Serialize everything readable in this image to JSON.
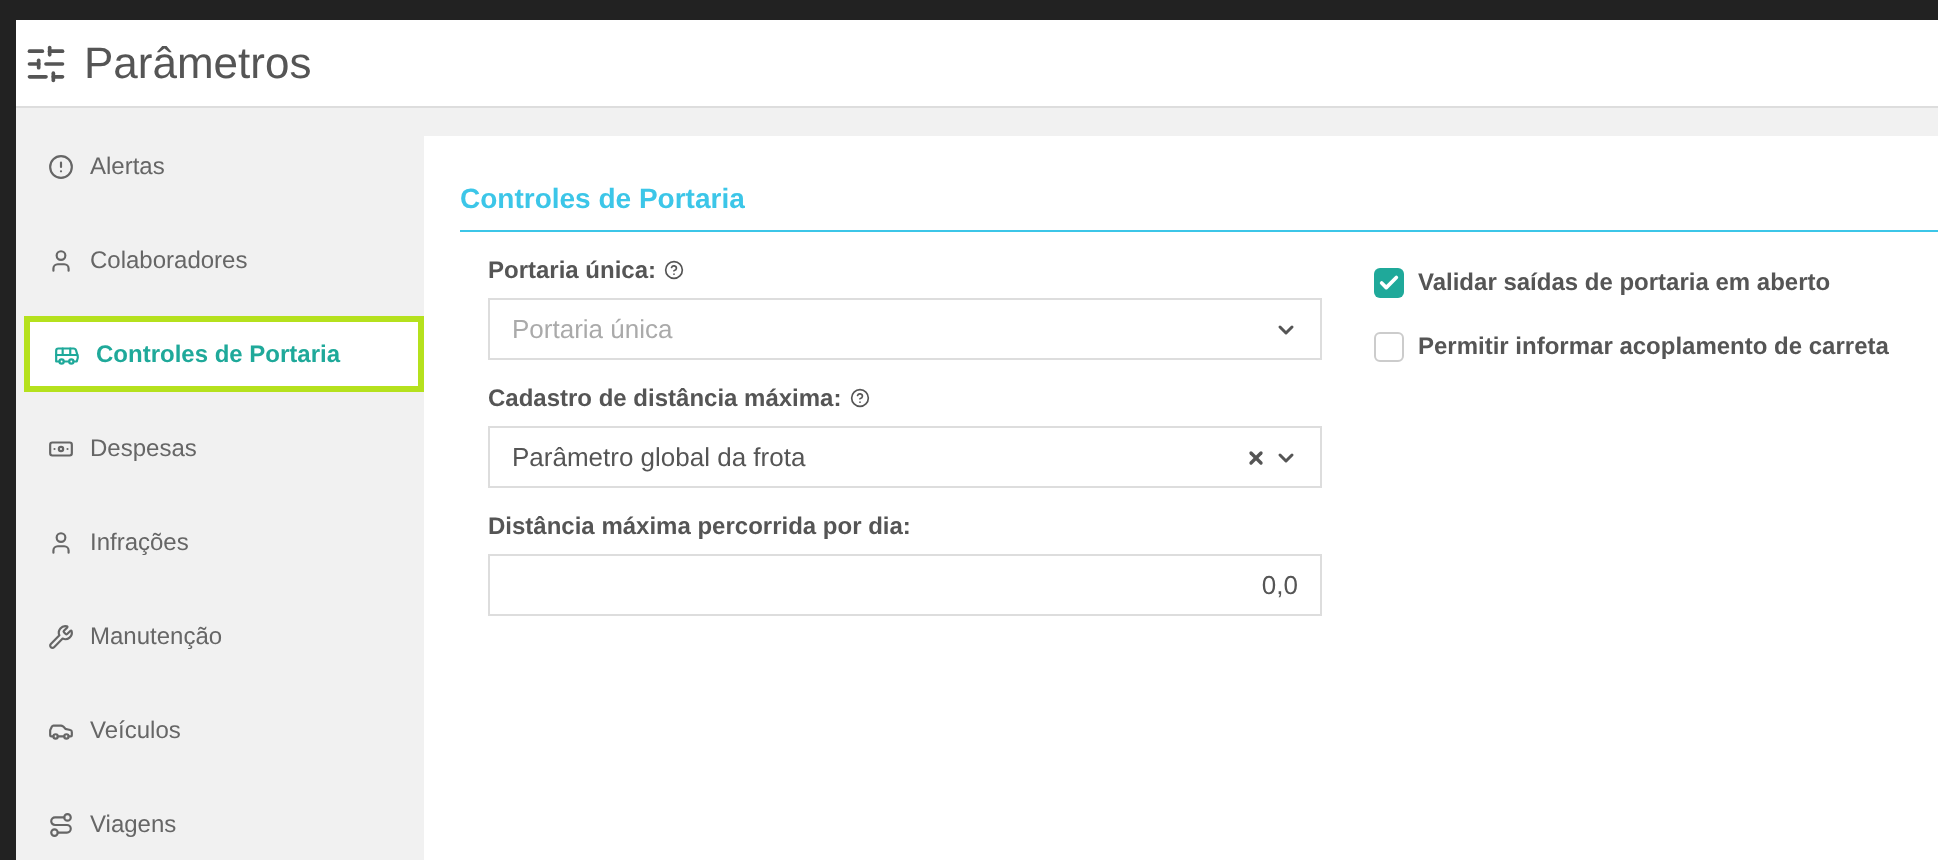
{
  "header": {
    "title": "Parâmetros"
  },
  "sidebar": {
    "items": [
      {
        "label": "Alertas",
        "selected": false
      },
      {
        "label": "Colaboradores",
        "selected": false
      },
      {
        "label": "Controles de Portaria",
        "selected": true
      },
      {
        "label": "Despesas",
        "selected": false
      },
      {
        "label": "Infrações",
        "selected": false
      },
      {
        "label": "Manutenção",
        "selected": false
      },
      {
        "label": "Veículos",
        "selected": false
      },
      {
        "label": "Viagens",
        "selected": false
      }
    ]
  },
  "section": {
    "title": "Controles de Portaria",
    "fields": [
      {
        "kind": "select",
        "label": "Portaria única:",
        "help": true,
        "placeholder": "Portaria única",
        "clearable": false
      },
      {
        "kind": "select",
        "label": "Cadastro de distância máxima:",
        "help": true,
        "value": "Parâmetro global da frota",
        "clearable": true
      },
      {
        "kind": "number",
        "label": "Distância máxima percorrida por dia:",
        "help": false,
        "value": "0,0"
      }
    ],
    "checkboxes": [
      {
        "label": "Validar saídas de portaria em aberto",
        "checked": true
      },
      {
        "label": "Permitir informar acoplamento de carreta",
        "checked": false
      }
    ]
  }
}
